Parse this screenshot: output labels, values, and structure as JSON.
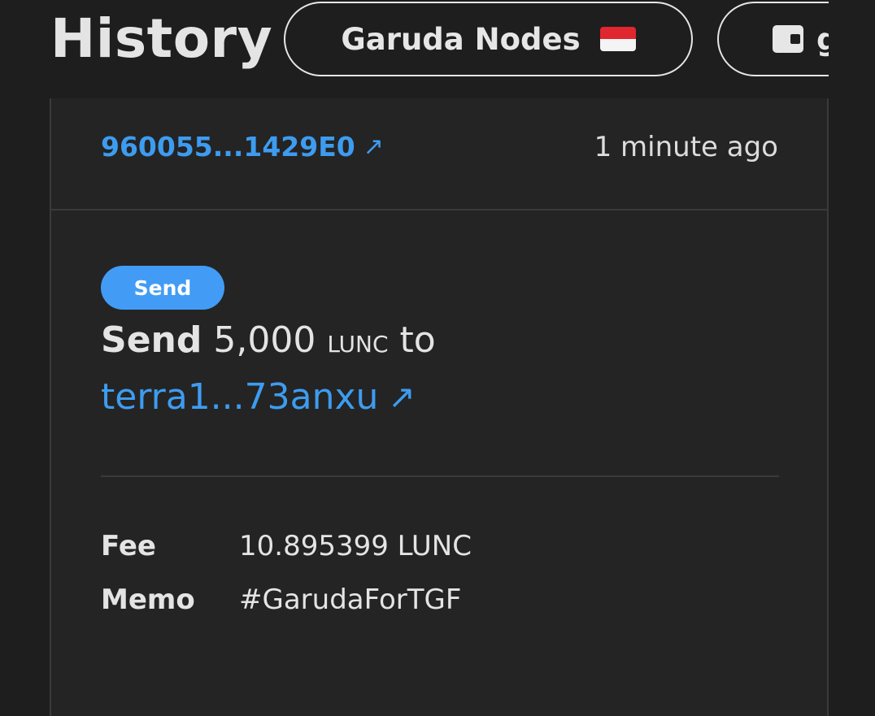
{
  "header": {
    "title": "History",
    "network": {
      "label": "Garuda Nodes",
      "flag_icon": "indonesia-flag-icon",
      "flag_colors": [
        "#e0262f",
        "#f4f4f4"
      ]
    },
    "wallet": {
      "icon": "wallet-icon",
      "label": "g"
    }
  },
  "transaction": {
    "hash": "960055...1429E0",
    "hash_arrow": "↗",
    "time": "1 minute ago",
    "type_badge": "Send",
    "message": {
      "action": "Send",
      "amount": "5,000",
      "denom": "LUNC",
      "preposition": "to",
      "recipient": "terra1...73anxu",
      "recipient_arrow": "↗"
    },
    "details": [
      {
        "label": "Fee",
        "value": "10.895399 LUNC"
      },
      {
        "label": "Memo",
        "value": "#GarudaForTGF"
      }
    ]
  },
  "colors": {
    "background": "#1e1e1e",
    "card": "#242424",
    "link": "#3d9cf0",
    "badge": "#429cf5",
    "text": "#e4e4e4"
  }
}
